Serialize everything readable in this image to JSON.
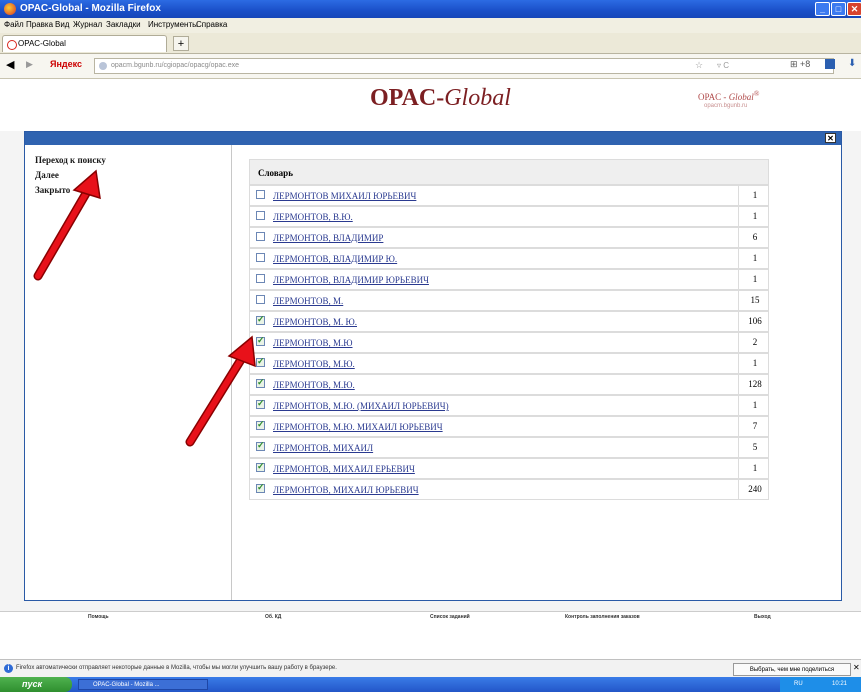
{
  "window": {
    "title": "OPAC-Global - Mozilla Firefox"
  },
  "menubar": [
    "Файл",
    "Правка",
    "Вид",
    "Журнал",
    "Закладки",
    "Инструменты",
    "Справка"
  ],
  "tab": {
    "label": "OPAC-Global"
  },
  "navbar": {
    "search_engine": "Яндекс",
    "url": "opacm.bgunb.ru/cgiopac/opacg/opac.exe"
  },
  "header": {
    "logo_prefix": "OPAC-",
    "logo_italic": "Global",
    "small_prefix": "OPAC - ",
    "small_italic": "Global",
    "small_sup": "®",
    "site": "opacm.bgunb.ru"
  },
  "sidebar": {
    "links": [
      "Переход к поиску",
      "Далее",
      "Закрыто"
    ]
  },
  "dictionary": {
    "title": "Словарь",
    "rows": [
      {
        "name": "ЛЕРМОНТОВ МИХАИЛ ЮРЬЕВИЧ",
        "count": "1",
        "checked": false
      },
      {
        "name": "ЛЕРМОНТОВ, В.Ю.",
        "count": "1",
        "checked": false
      },
      {
        "name": "ЛЕРМОНТОВ, ВЛАДИМИР",
        "count": "6",
        "checked": false
      },
      {
        "name": "ЛЕРМОНТОВ, ВЛАДИМИР Ю.",
        "count": "1",
        "checked": false
      },
      {
        "name": "ЛЕРМОНТОВ, ВЛАДИМИР ЮРЬЕВИЧ",
        "count": "1",
        "checked": false
      },
      {
        "name": "ЛЕРМОНТОВ, М.",
        "count": "15",
        "checked": false
      },
      {
        "name": "ЛЕРМОНТОВ, М. Ю.",
        "count": "106",
        "checked": true
      },
      {
        "name": "ЛЕРМОНТОВ, М.Ю",
        "count": "2",
        "checked": true
      },
      {
        "name": "ЛЕРМОНТОВ, М.Ю.",
        "count": "1",
        "checked": true
      },
      {
        "name": "ЛЕРМОНТОВ, М.Ю.",
        "count": "128",
        "checked": true
      },
      {
        "name": "ЛЕРМОНТОВ, М.Ю. (МИХАИЛ ЮРЬЕВИЧ)",
        "count": "1",
        "checked": true
      },
      {
        "name": "ЛЕРМОНТОВ, М.Ю. МИХАИЛ ЮРЬЕВИЧ",
        "count": "7",
        "checked": true
      },
      {
        "name": "ЛЕРМОНТОВ, МИХАИЛ",
        "count": "5",
        "checked": true
      },
      {
        "name": "ЛЕРМОНТОВ, МИХАИЛ ЕРЬЕВИЧ",
        "count": "1",
        "checked": true
      },
      {
        "name": "ЛЕРМОНТОВ, МИХАИЛ ЮРЬЕВИЧ",
        "count": "240",
        "checked": true
      }
    ]
  },
  "footer_menu": [
    "Помощь",
    "Об. КД",
    "Список заданий",
    "Контроль заполнения заказов",
    "Выход"
  ],
  "notification": {
    "message": "Firefox автоматически отправляет некоторые данные в Mozilla, чтобы мы могли улучшить вашу работу в браузере.",
    "button": "Выбрать, чем мне поделиться",
    "close": "✕"
  },
  "taskbar": {
    "start": "пуск",
    "task": "OPAC-Global - Mozilla ...",
    "lang": "RU",
    "clock": "10:21"
  },
  "colors": {
    "link": "#2a3a90",
    "modal_header": "#2f63b0",
    "logo": "#7c1f22",
    "arrow": "#e8111a"
  }
}
